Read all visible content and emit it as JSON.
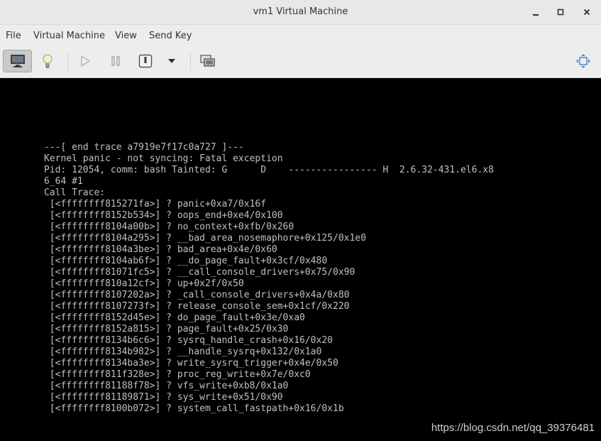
{
  "window": {
    "title": "vm1 Virtual Machine"
  },
  "menubar": {
    "items": [
      "File",
      "Virtual Machine",
      "View",
      "Send Key"
    ]
  },
  "console": {
    "lines": [
      "---[ end trace a7919e7f17c0a727 ]---",
      "Kernel panic - not syncing: Fatal exception",
      "Pid: 12054, comm: bash Tainted: G      D    ---------------- H  2.6.32-431.el6.x8",
      "6_64 #1",
      "Call Trace:",
      " [<ffffffff815271fa>] ? panic+0xa7/0x16f",
      " [<ffffffff8152b534>] ? oops_end+0xe4/0x100",
      " [<ffffffff8104a00b>] ? no_context+0xfb/0x260",
      " [<ffffffff8104a295>] ? __bad_area_nosemaphore+0x125/0x1e0",
      " [<ffffffff8104a3be>] ? bad_area+0x4e/0x60",
      " [<ffffffff8104ab6f>] ? __do_page_fault+0x3cf/0x480",
      " [<ffffffff81071fc5>] ? __call_console_drivers+0x75/0x90",
      " [<ffffffff810a12cf>] ? up+0x2f/0x50",
      " [<ffffffff8107202a>] ? _call_console_drivers+0x4a/0x80",
      " [<ffffffff8107273f>] ? release_console_sem+0x1cf/0x220",
      " [<ffffffff8152d45e>] ? do_page_fault+0x3e/0xa0",
      " [<ffffffff8152a815>] ? page_fault+0x25/0x30",
      " [<ffffffff8134b6c6>] ? sysrq_handle_crash+0x16/0x20",
      " [<ffffffff8134b982>] ? __handle_sysrq+0x132/0x1a0",
      " [<ffffffff8134ba3e>] ? write_sysrq_trigger+0x4e/0x50",
      " [<ffffffff811f328e>] ? proc_reg_write+0x7e/0xc0",
      " [<ffffffff81188f78>] ? vfs_write+0xb8/0x1a0",
      " [<ffffffff81189871>] ? sys_write+0x51/0x90",
      " [<ffffffff8100b072>] ? system_call_fastpath+0x16/0x1b"
    ]
  },
  "watermark": "https://blog.csdn.net/qq_39376481",
  "colors": {
    "console_bg": "#000000",
    "console_text": "#c0c0c0",
    "chrome_bg": "#ededed"
  },
  "icons": {
    "window": [
      "minimize-icon",
      "maximize-icon",
      "close-icon"
    ],
    "toolbar": [
      "monitor-icon",
      "lightbulb-icon",
      "play-icon",
      "pause-icon",
      "power-icon",
      "chevron-down-icon",
      "snapshots-icon",
      "fullscreen-icon"
    ]
  }
}
